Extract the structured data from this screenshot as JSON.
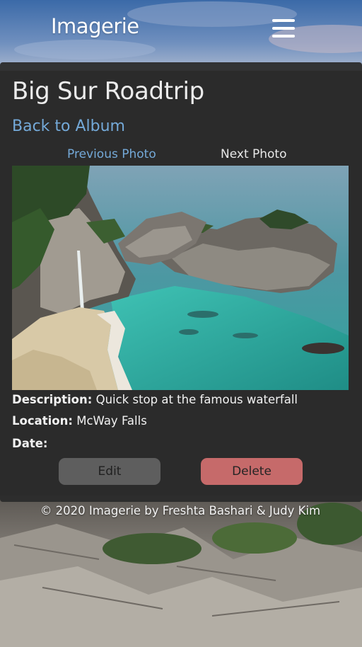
{
  "header": {
    "brand": "Imagerie",
    "menu_icon": "hamburger-menu-icon"
  },
  "album": {
    "title": "Big Sur Roadtrip",
    "back_link": "Back to Album",
    "prev_link": "Previous Photo",
    "next_link": "Next Photo"
  },
  "photo": {
    "alt": "McWay Falls coastline photo",
    "description_label": "Description:",
    "description": "Quick stop at the famous waterfall",
    "location_label": "Location:",
    "location": "McWay Falls",
    "date_label": "Date:",
    "date": ""
  },
  "actions": {
    "edit_label": "Edit",
    "delete_label": "Delete"
  },
  "footer": {
    "text": "© 2020 Imagerie by Freshta Bashari & Judy Kim"
  },
  "colors": {
    "link": "#74a9d8",
    "card_bg": "#2a2a2a",
    "edit_bg": "#5e5e5e",
    "delete_bg": "#c66a6a"
  }
}
